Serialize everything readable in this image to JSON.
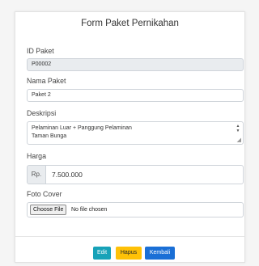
{
  "form": {
    "title": "Form Paket Pernikahan",
    "id_label": "ID Paket",
    "id_value": "P00002",
    "nama_label": "Nama Paket",
    "nama_value": "Paket 2",
    "deskripsi_label": "Deskripsi",
    "deskripsi_line1": "Pelaminan Luar + Panggung Pelaminan",
    "deskripsi_line2": "Taman Bunga",
    "harga_label": "Harga",
    "harga_prefix": "Rp.",
    "harga_value": "7.500.000",
    "foto_label": "Foto Cover",
    "file_button": "Choose File",
    "file_status": "No file chosen"
  },
  "actions": {
    "edit": "Edit",
    "hapus": "Hapus",
    "kembali": "Kembali"
  },
  "colors": {
    "edit": "#17a2b8",
    "hapus": "#ffc107",
    "kembali": "#1a6fd6"
  }
}
